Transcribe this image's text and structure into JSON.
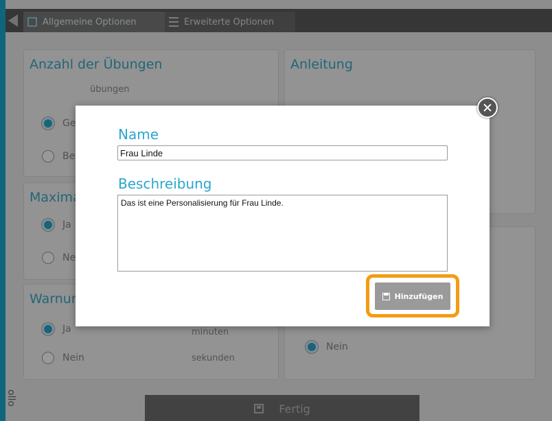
{
  "tabs": [
    {
      "label": "Allgemeine Optionen",
      "icon": "window-icon"
    },
    {
      "label": "Erweiterte Optionen",
      "icon": "list-icon"
    }
  ],
  "cards": {
    "anzahl": {
      "title": "Anzahl der Übungen",
      "sub": "übungen",
      "opt1": "Ge",
      "opt2": "Be"
    },
    "anleitung": {
      "title": "Anleitung"
    },
    "maxima": {
      "title": "Maxima",
      "opt1": "Ja",
      "opt2": "Ne"
    },
    "warnung": {
      "title": "Warnun",
      "opt1": "Ja",
      "opt2": "Nein",
      "sub1": "minuten",
      "sub2": "sekunden"
    },
    "right_bottom": {
      "opt": "Nein"
    }
  },
  "fertig_label": "Fertig",
  "side_text": "ollo",
  "modal": {
    "name_label": "Name",
    "name_value": "Frau Linde",
    "desc_label": "Beschreibung",
    "desc_value": "Das ist eine Personalisierung für Frau Linde.",
    "add_label": "Hinzufügen"
  },
  "colors": {
    "accent": "#2aa6cd",
    "highlight": "#f39c12",
    "frame": "#1aa9cf"
  }
}
